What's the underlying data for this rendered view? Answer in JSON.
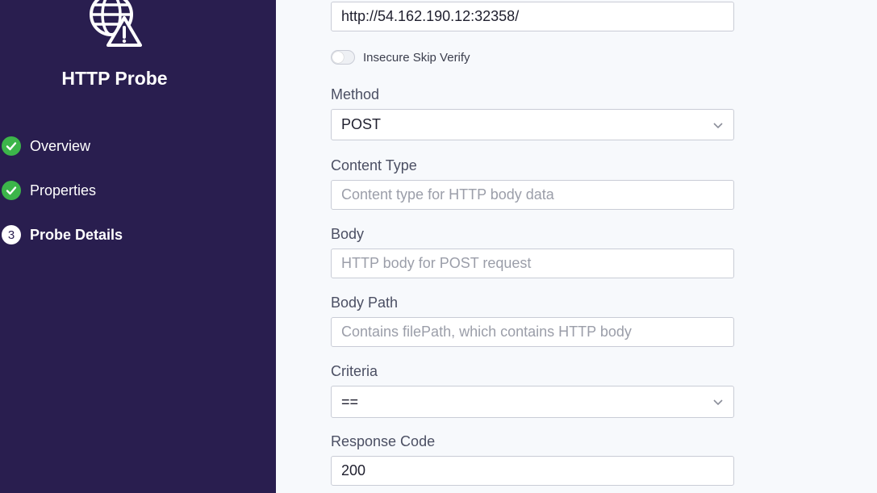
{
  "sidebar": {
    "title": "HTTP Probe",
    "logo_icon": "globe-warning-icon",
    "steps": [
      {
        "label": "Overview",
        "status": "done",
        "icon": "check-icon"
      },
      {
        "label": "Properties",
        "status": "done",
        "icon": "check-icon"
      },
      {
        "label": "Probe Details",
        "status": "current",
        "number": "3"
      }
    ],
    "colors": {
      "background": "#291e4f",
      "done": "#3cb54a"
    }
  },
  "form": {
    "url": {
      "value": "http://54.162.190.12:32358/"
    },
    "insecure_skip_verify": {
      "label": "Insecure Skip Verify",
      "checked": false
    },
    "method": {
      "label": "Method",
      "value": "POST",
      "icon": "chevron-down-icon"
    },
    "content_type": {
      "label": "Content Type",
      "placeholder": "Content type for HTTP body data"
    },
    "body": {
      "label": "Body",
      "placeholder": "HTTP body for POST request"
    },
    "body_path": {
      "label": "Body Path",
      "placeholder": "Contains filePath, which contains HTTP body"
    },
    "criteria": {
      "label": "Criteria",
      "value": "==",
      "icon": "chevron-down-icon"
    },
    "response_code": {
      "label": "Response Code",
      "value": "200"
    }
  }
}
